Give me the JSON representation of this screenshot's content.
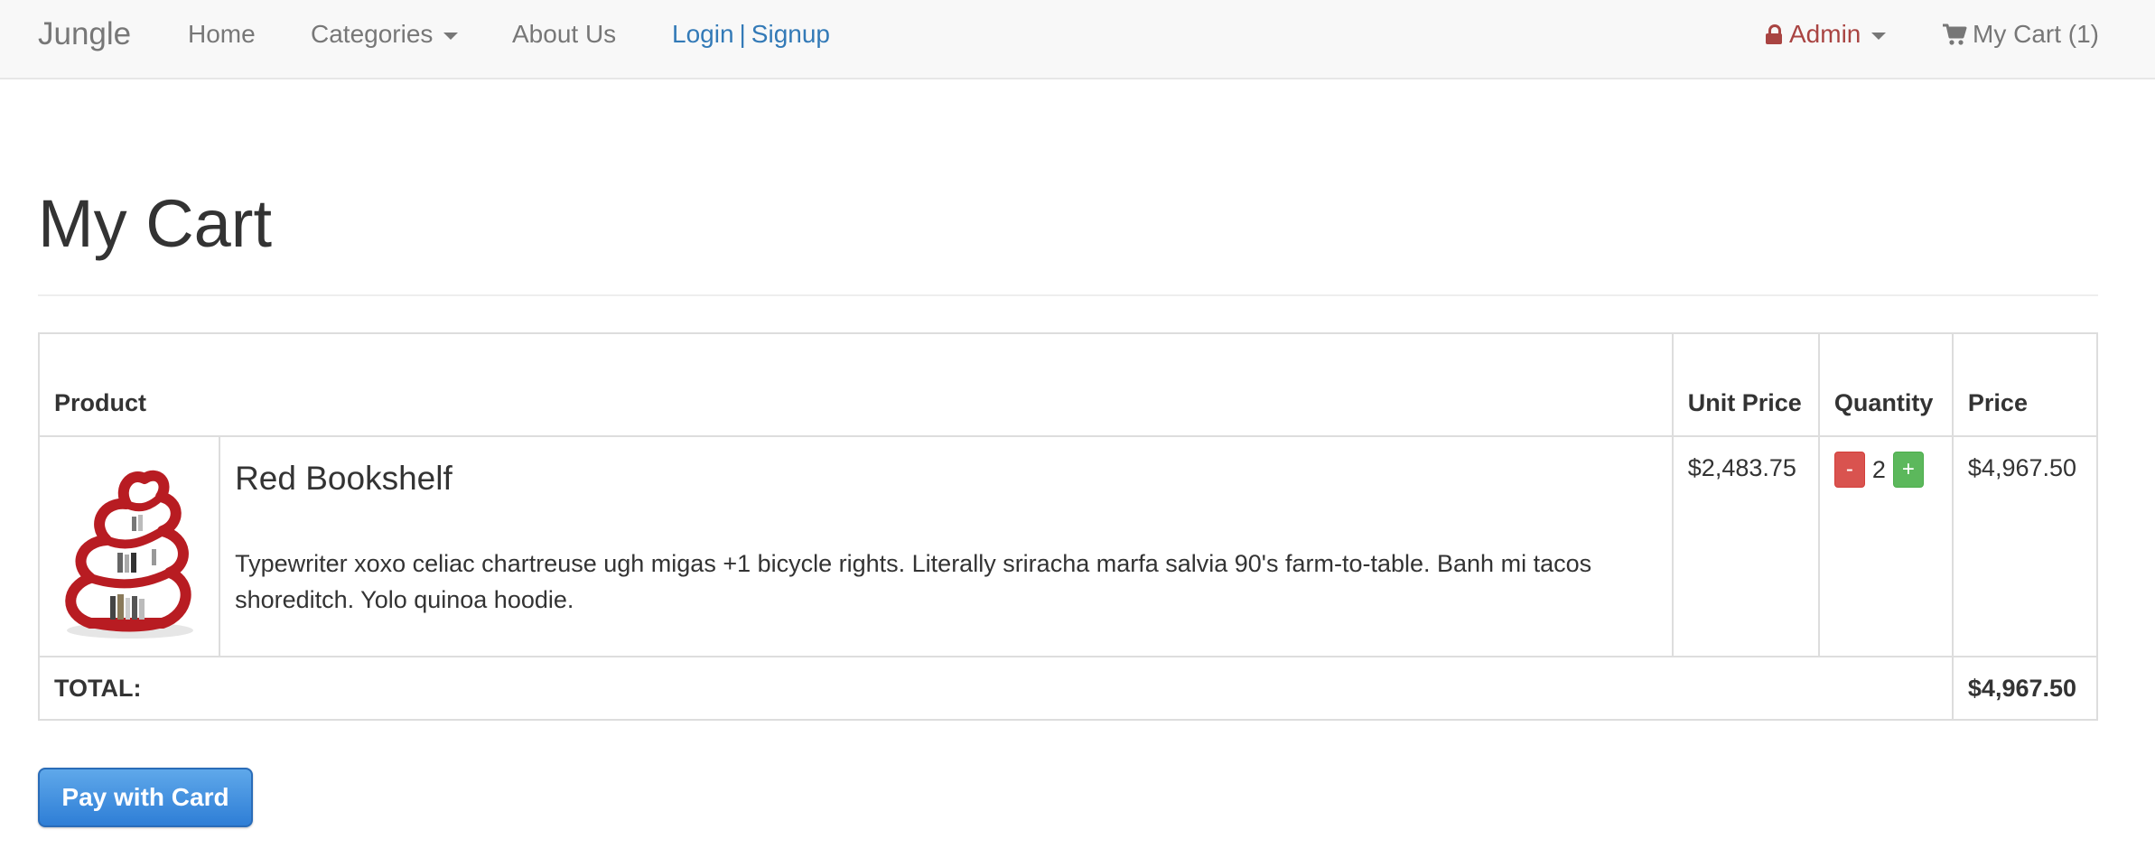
{
  "nav": {
    "brand": "Jungle",
    "home": "Home",
    "categories": "Categories",
    "about": "About Us",
    "login": "Login",
    "separator": "|",
    "signup": "Signup",
    "admin": "Admin",
    "cart": "My Cart (1)"
  },
  "page": {
    "title": "My Cart"
  },
  "table": {
    "headers": {
      "product": "Product",
      "unit_price": "Unit Price",
      "quantity": "Quantity",
      "price": "Price"
    },
    "items": [
      {
        "name": "Red Bookshelf",
        "description": "Typewriter xoxo celiac chartreuse ugh migas +1 bicycle rights. Literally sriracha marfa salvia 90's farm-to-table. Banh mi tacos shoreditch. Yolo quinoa hoodie.",
        "unit_price": "$2,483.75",
        "quantity": "2",
        "decrease_label": "-",
        "increase_label": "+",
        "price": "$4,967.50"
      }
    ],
    "total_label": "TOTAL:",
    "total_value": "$4,967.50"
  },
  "checkout": {
    "pay_label": "Pay with Card"
  },
  "colors": {
    "navbar_bg": "#f8f8f8",
    "link": "#337ab7",
    "admin": "#a94442",
    "danger": "#d9534f",
    "success": "#5cb85c",
    "pay_button": "#2e7ed6"
  },
  "icons": {
    "admin": "lock-icon",
    "cart": "shopping-cart-icon",
    "dropdown": "caret-down-icon",
    "product": "bookshelf-image"
  }
}
